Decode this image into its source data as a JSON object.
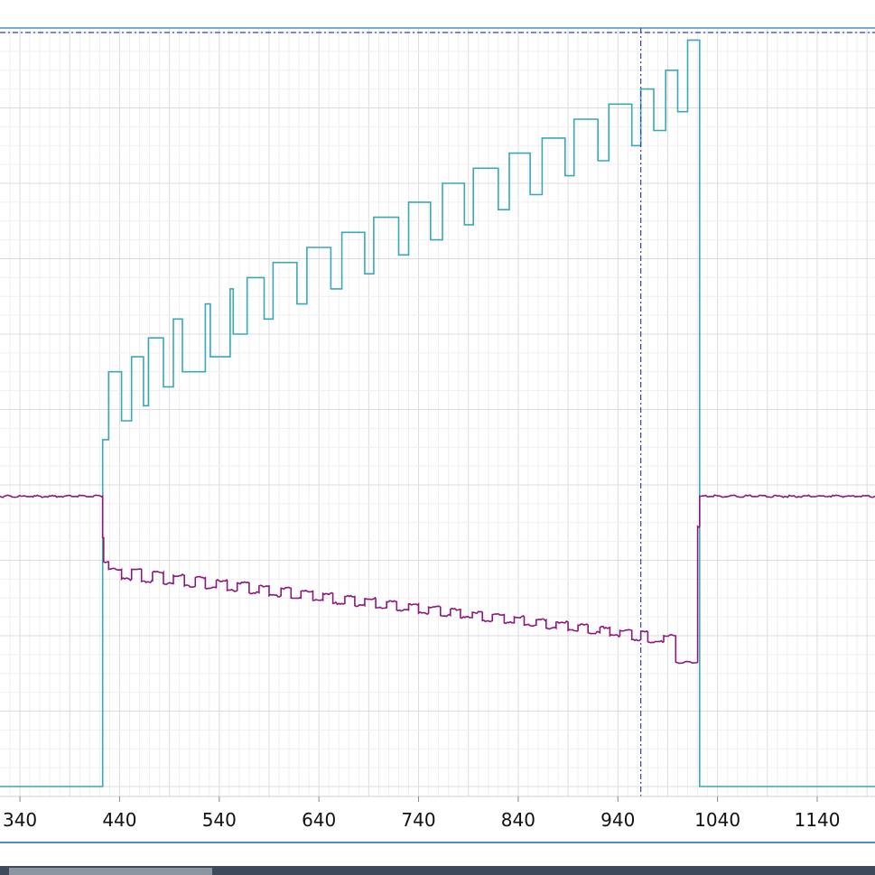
{
  "colors": {
    "background": "#ffffff",
    "frame": "#4a90c8",
    "grid": "#e4e4e4",
    "cyan_series": "#3aa8b6",
    "purple_series": "#8a1a7a",
    "cursor": "#3340b0",
    "scrollbar": "#3d4a5c"
  },
  "chart_data": {
    "type": "line",
    "x_tick_labels": [
      "340",
      "440",
      "540",
      "640",
      "740",
      "840",
      "940",
      "1040",
      "1140"
    ],
    "xlim": [
      320,
      1198
    ],
    "ylim": [
      0,
      100
    ],
    "grid": true,
    "cursor": {
      "x": 963,
      "y": 100
    },
    "series": [
      {
        "step": true,
        "x": [
          320,
          423,
          423,
          429,
          429,
          442,
          442,
          452,
          452,
          464,
          464,
          469,
          469,
          484,
          484,
          494,
          494,
          503,
          503,
          526,
          526,
          531,
          531,
          551,
          551,
          554,
          554,
          568,
          568,
          585,
          585,
          594,
          594,
          618,
          618,
          628,
          628,
          652,
          652,
          663,
          663,
          686,
          686,
          695,
          695,
          720,
          720,
          730,
          730,
          752,
          752,
          764,
          764,
          786,
          786,
          795,
          795,
          820,
          820,
          831,
          831,
          852,
          852,
          864,
          864,
          887,
          887,
          896,
          896,
          920,
          920,
          931,
          931,
          954,
          954,
          963,
          963,
          976,
          976,
          988,
          988,
          1000,
          1000,
          1010,
          1010,
          1022,
          1022,
          1198
        ],
        "y": [
          0,
          0,
          46,
          46,
          55,
          55,
          48.5,
          48.5,
          57,
          57,
          50.5,
          50.5,
          59.5,
          59.5,
          53,
          53,
          62,
          62,
          55,
          55,
          64,
          64,
          57,
          57,
          66,
          66,
          60,
          60,
          67.5,
          67.5,
          62,
          62,
          69.5,
          69.5,
          64,
          64,
          71.5,
          71.5,
          66,
          66,
          73.5,
          73.5,
          68,
          68,
          75.5,
          75.5,
          70.5,
          70.5,
          77.5,
          77.5,
          72.5,
          72.5,
          80,
          80,
          74.5,
          74.5,
          82,
          82,
          76.5,
          76.5,
          84,
          84,
          78.5,
          78.5,
          86,
          86,
          81,
          81,
          88.5,
          88.5,
          83,
          83,
          90.5,
          90.5,
          85,
          85,
          92.5,
          92.5,
          87,
          87,
          95,
          95,
          89.5,
          89.5,
          99,
          99,
          0,
          0
        ]
      },
      {
        "step": true,
        "noise": 0.15,
        "x": [
          320,
          423,
          423,
          424,
          424,
          429,
          429,
          442,
          442,
          452,
          452,
          462,
          462,
          473,
          473,
          484,
          484,
          494,
          494,
          505,
          505,
          516,
          516,
          526,
          526,
          537,
          537,
          548,
          548,
          558,
          558,
          570,
          570,
          580,
          580,
          590,
          590,
          602,
          602,
          612,
          612,
          622,
          622,
          634,
          634,
          644,
          644,
          654,
          654,
          666,
          666,
          676,
          676,
          686,
          686,
          697,
          697,
          708,
          708,
          718,
          718,
          730,
          730,
          740,
          740,
          750,
          750,
          762,
          762,
          772,
          772,
          782,
          782,
          794,
          794,
          804,
          804,
          814,
          814,
          826,
          826,
          836,
          836,
          846,
          846,
          858,
          858,
          868,
          868,
          878,
          878,
          890,
          890,
          900,
          900,
          910,
          910,
          922,
          922,
          932,
          932,
          942,
          942,
          954,
          954,
          963,
          963,
          970,
          970,
          986,
          986,
          998,
          998,
          1020,
          1020,
          1022,
          1022,
          1198
        ],
        "y": [
          38.5,
          38.5,
          33,
          33,
          29.8,
          29.8,
          28.8,
          28.8,
          27.5,
          27.5,
          28.8,
          28.8,
          27.2,
          27.2,
          28.4,
          28.4,
          26.9,
          26.9,
          28,
          28,
          26.6,
          26.6,
          27.7,
          27.7,
          26.3,
          26.3,
          27.3,
          27.3,
          26,
          26,
          27,
          27,
          25.7,
          25.7,
          26.6,
          26.6,
          25.3,
          25.3,
          26.3,
          26.3,
          25,
          25,
          25.9,
          25.9,
          24.7,
          24.7,
          25.6,
          25.6,
          24.3,
          24.3,
          25.2,
          25.2,
          24,
          24,
          24.9,
          24.9,
          23.7,
          23.7,
          24.5,
          24.5,
          23.4,
          23.4,
          24.2,
          24.2,
          23,
          23,
          23.8,
          23.8,
          22.7,
          22.7,
          23.5,
          23.5,
          22.4,
          22.4,
          23.1,
          23.1,
          22,
          22,
          22.8,
          22.8,
          21.7,
          21.7,
          22.5,
          22.5,
          21.4,
          21.4,
          22.1,
          22.1,
          21,
          21,
          21.8,
          21.8,
          20.7,
          20.7,
          21.4,
          21.4,
          20.4,
          20.4,
          21.1,
          21.1,
          20,
          20,
          20.7,
          20.7,
          19.5,
          19.5,
          20.5,
          20.5,
          19.2,
          19.2,
          20,
          20,
          16.5,
          16.5,
          34.5,
          34.5,
          38.5,
          38.5
        ]
      }
    ]
  }
}
